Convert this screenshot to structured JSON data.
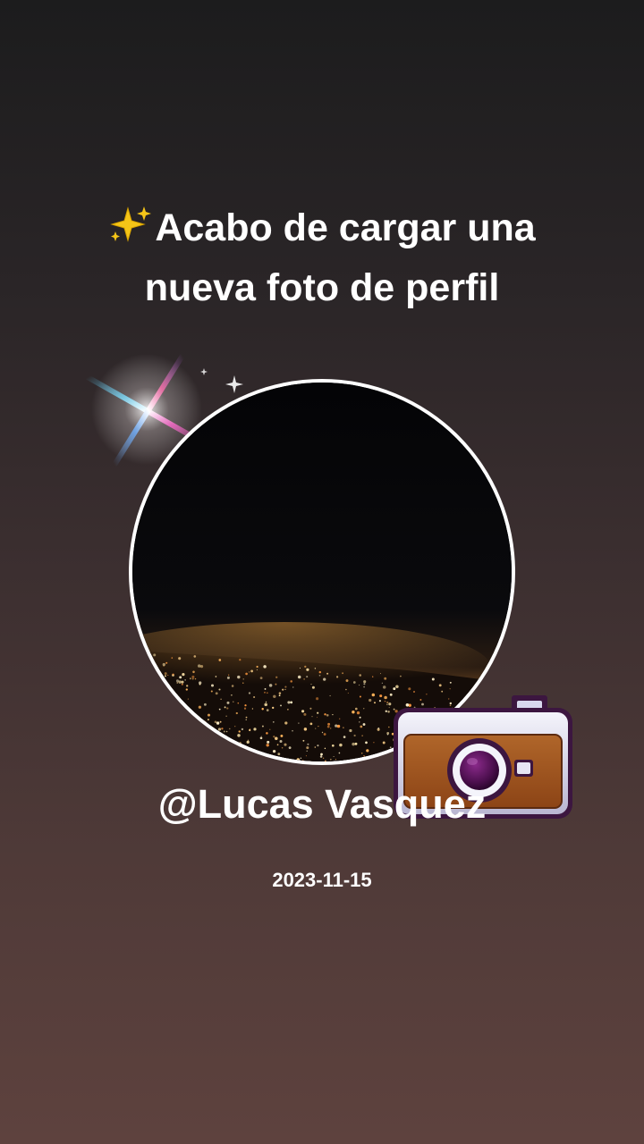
{
  "post": {
    "headline_line1": "Acabo de cargar una",
    "headline_line2": "nueva foto de perfil",
    "headline_emoji": "sparkles-icon",
    "username": "@Lucas Vasquez",
    "date": "2023-11-15"
  },
  "theme": {
    "background_top": "#1c1c1d",
    "background_bottom": "#5e423e",
    "text_color": "#ffffff",
    "avatar_border": "#ffffff",
    "camera_body": "#a0561c",
    "camera_lens": "#6a1a6a"
  },
  "icons": {
    "headline": "sparkles-icon",
    "flare": "lens-flare-icon",
    "camera": "camera-icon"
  }
}
